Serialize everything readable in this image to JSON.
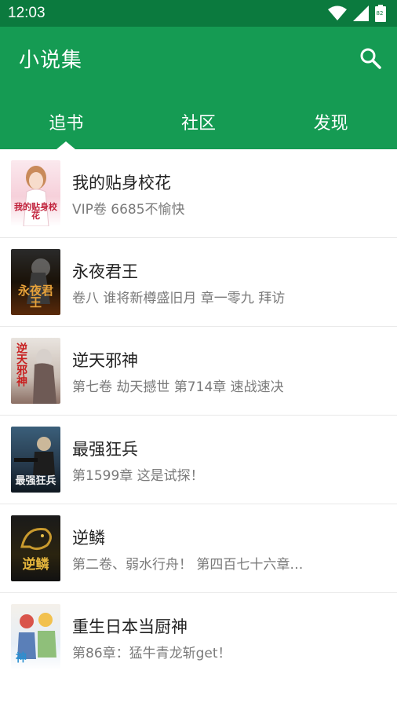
{
  "status_bar": {
    "time": "12:03",
    "battery": "82"
  },
  "app_bar": {
    "title": "小说集"
  },
  "tabs": [
    {
      "label": "追书"
    },
    {
      "label": "社区"
    },
    {
      "label": "发现"
    }
  ],
  "books": [
    {
      "title": "我的贴身校花",
      "subtitle": "VIP卷 6685不愉快",
      "cover_text": "我的贴身校花"
    },
    {
      "title": "永夜君王",
      "subtitle": "卷八 谁将新樽盛旧月 章一零九 拜访",
      "cover_text": "永夜君王"
    },
    {
      "title": "逆天邪神",
      "subtitle": "第七卷 劫天撼世 第714章 速战速决",
      "cover_text": "逆天邪神"
    },
    {
      "title": "最强狂兵",
      "subtitle": "第1599章 这是试探！",
      "cover_text": "最强狂兵"
    },
    {
      "title": "逆鳞",
      "subtitle": "第二卷、弱水行舟！ 第四百七十六章…",
      "cover_text": "逆鳞"
    },
    {
      "title": "重生日本当厨神",
      "subtitle": "第86章：猛牛青龙斩get！",
      "cover_text": "神"
    }
  ],
  "colors": {
    "status_bar": "#0b7a3e",
    "app_bar": "#159b53"
  }
}
